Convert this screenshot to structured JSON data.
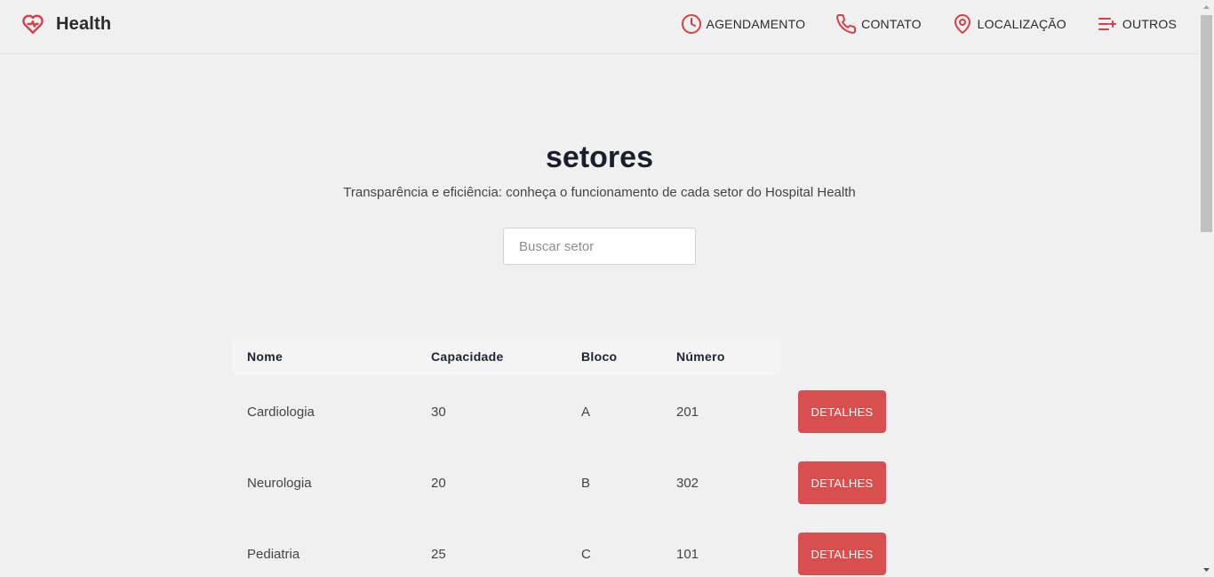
{
  "header": {
    "brand": "Health",
    "logo_icon": "heart-pulse-icon",
    "accent_color": "#d63f47",
    "nav": [
      {
        "label": "AGENDAMENTO",
        "icon": "clock-icon"
      },
      {
        "label": "CONTATO",
        "icon": "phone-icon"
      },
      {
        "label": "LOCALIZAÇÃO",
        "icon": "map-pin-icon"
      },
      {
        "label": "OUTROS",
        "icon": "list-plus-icon"
      }
    ]
  },
  "hero": {
    "title": "setores",
    "subtitle": "Transparência e eficiência: conheça o funcionamento de cada setor do Hospital Health",
    "search_placeholder": "Buscar setor",
    "search_value": ""
  },
  "table": {
    "columns": [
      "Nome",
      "Capacidade",
      "Bloco",
      "Número"
    ],
    "rows": [
      {
        "nome": "Cardiologia",
        "capacidade": "30",
        "bloco": "A",
        "numero": "201",
        "action": "DETALHES"
      },
      {
        "nome": "Neurologia",
        "capacidade": "20",
        "bloco": "B",
        "numero": "302",
        "action": "DETALHES"
      },
      {
        "nome": "Pediatria",
        "capacidade": "25",
        "bloco": "C",
        "numero": "101",
        "action": "DETALHES"
      }
    ],
    "button_color": "#d94f50"
  }
}
